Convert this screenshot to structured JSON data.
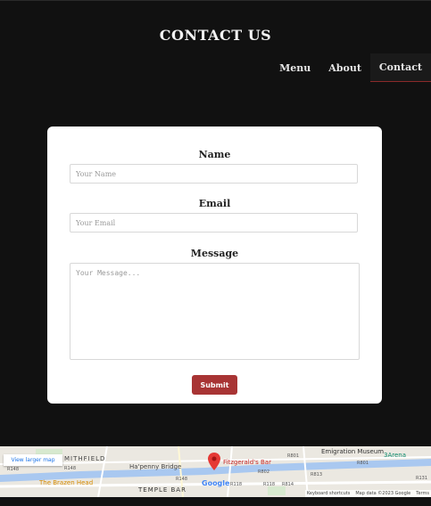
{
  "header": {
    "title": "CONTACT US",
    "nav": [
      {
        "label": "Menu",
        "active": false
      },
      {
        "label": "About",
        "active": false
      },
      {
        "label": "Contact",
        "active": true
      }
    ]
  },
  "form": {
    "name_label": "Name",
    "name_placeholder": "Your Name",
    "email_label": "Email",
    "email_placeholder": "Your Email",
    "message_label": "Message",
    "message_placeholder": "Your Message...",
    "submit_label": "Submit"
  },
  "map": {
    "view_larger": "View larger map",
    "places": {
      "emigration_museum": "Emigration Museum",
      "three_arena": "3Arena",
      "smithfield": "MITHFIELD",
      "hapenny_bridge": "Ha'penny Bridge",
      "fitzgeralds_bar": "Fitzgerald's Bar",
      "brazen_head": "The Brazen Head",
      "temple_bar": "TEMPLE BAR",
      "google": "Google"
    },
    "roads": [
      "R801",
      "R802",
      "R814",
      "R813",
      "R131",
      "R801",
      "R148",
      "R148",
      "R148",
      "R118",
      "R118"
    ],
    "attribution": {
      "shortcuts": "Keyboard shortcuts",
      "data": "Map data ©2023 Google",
      "terms": "Terms"
    }
  },
  "colors": {
    "background": "#111111",
    "accent": "#a83434",
    "card": "#ffffff"
  }
}
